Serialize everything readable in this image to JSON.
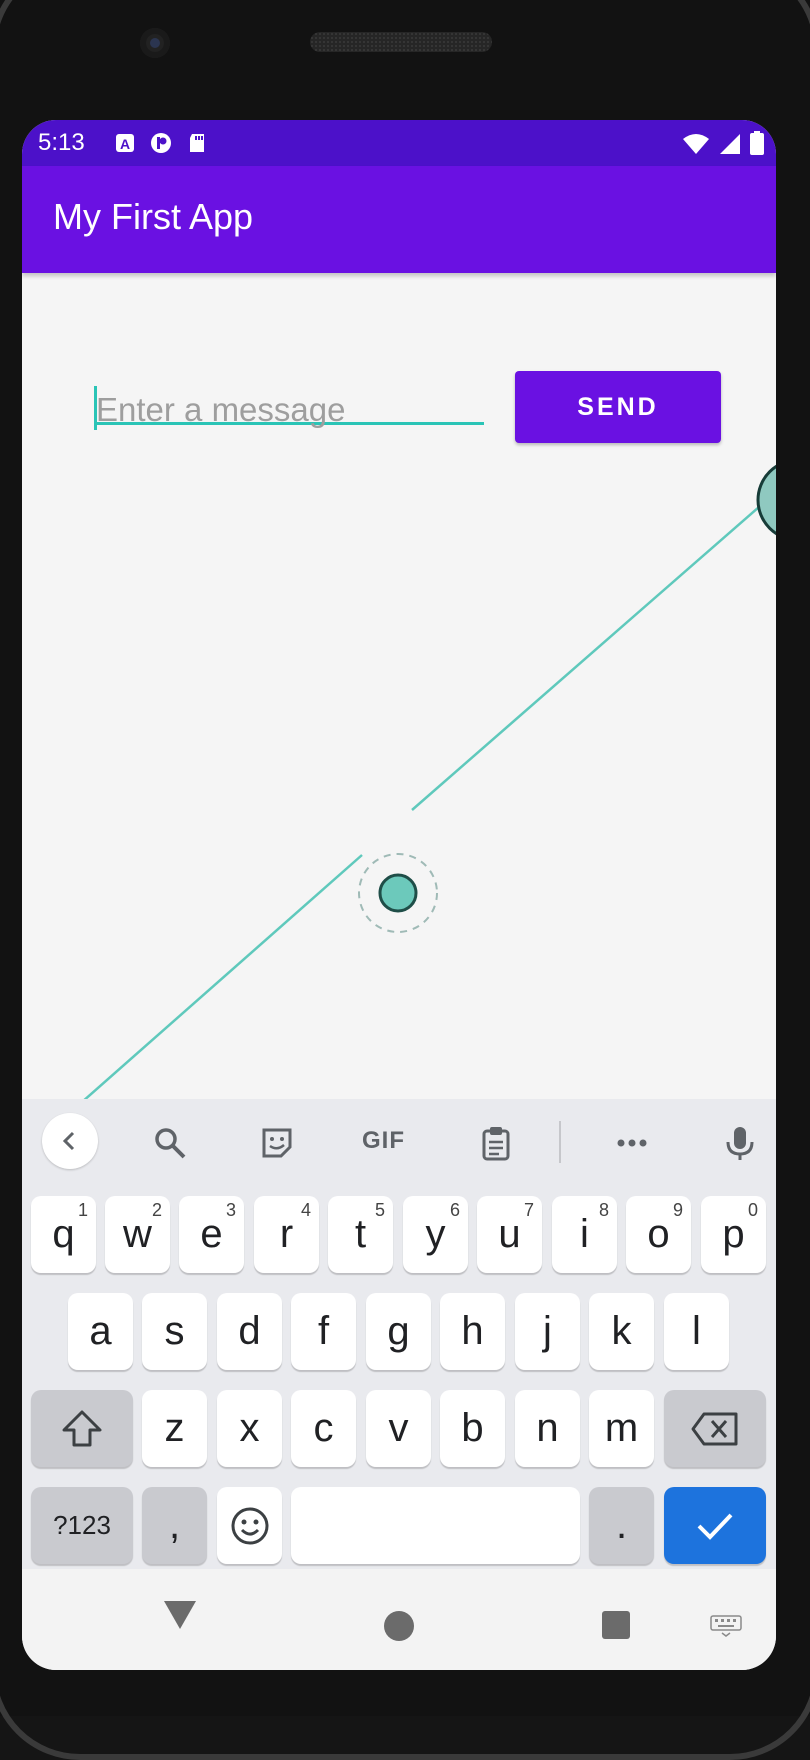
{
  "status_bar": {
    "time": "5:13",
    "icons_left": [
      "a-badge-icon",
      "p-circle-icon",
      "sd-card-icon"
    ],
    "icons_right": [
      "wifi-icon",
      "signal-icon",
      "battery-icon"
    ],
    "color": "#4c11c9"
  },
  "app_bar": {
    "title": "My First App",
    "color": "#6a11e2"
  },
  "message": {
    "placeholder": "Enter a message",
    "value": ""
  },
  "send_button": {
    "label": "SEND"
  },
  "keyboard": {
    "toolbar": [
      "back-arrow-icon",
      "search-icon",
      "sticker-icon",
      "gif-label",
      "clipboard-icon",
      "more-icon",
      "mic-icon"
    ],
    "gif_label": "GIF",
    "row1": [
      {
        "key": "q",
        "hint": "1"
      },
      {
        "key": "w",
        "hint": "2"
      },
      {
        "key": "e",
        "hint": "3"
      },
      {
        "key": "r",
        "hint": "4"
      },
      {
        "key": "t",
        "hint": "5"
      },
      {
        "key": "y",
        "hint": "6"
      },
      {
        "key": "u",
        "hint": "7"
      },
      {
        "key": "i",
        "hint": "8"
      },
      {
        "key": "o",
        "hint": "9"
      },
      {
        "key": "p",
        "hint": "0"
      }
    ],
    "row2": [
      "a",
      "s",
      "d",
      "f",
      "g",
      "h",
      "j",
      "k",
      "l"
    ],
    "row3": [
      "z",
      "x",
      "c",
      "v",
      "b",
      "n",
      "m"
    ],
    "row4": {
      "symbols": "?123",
      "comma": ",",
      "period": "."
    },
    "accent_color": "#1d73dd"
  },
  "nav_bar": {
    "buttons": [
      "back-icon",
      "home-icon",
      "recents-icon",
      "keyboard-switch-icon"
    ]
  }
}
